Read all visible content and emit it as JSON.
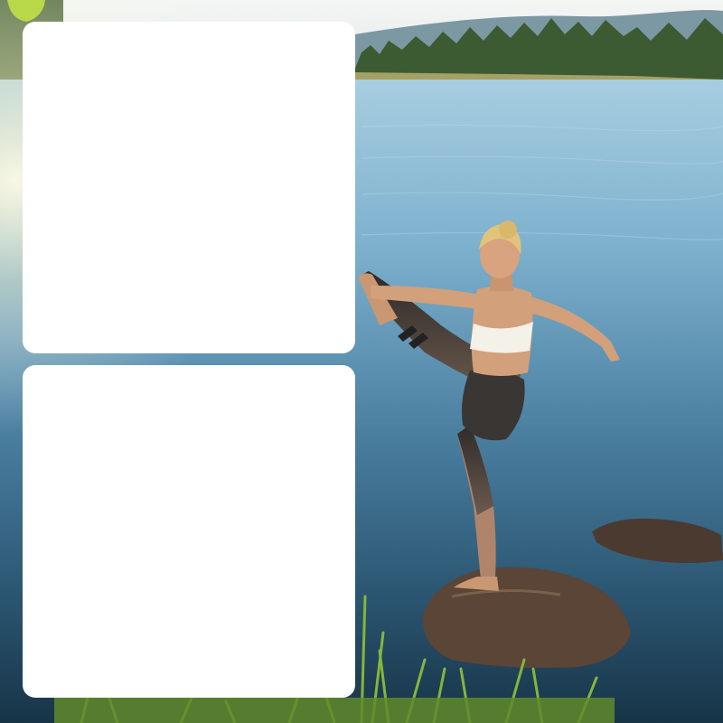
{
  "scene": {
    "description_icon": "photo-background",
    "colors": {
      "sky": "#e9eef0",
      "hills": "#6f8f9a",
      "treeline": "#3f5a35",
      "shore": "#9c9a5e",
      "water_top": "#a9d0e3",
      "water_mid": "#4d86a8",
      "water_bottom": "#1c3d55",
      "rock": "#5b4637",
      "grass": "#7fae3a",
      "skin": "#d7a37c",
      "hair": "#e2c37a",
      "top": "#f4f2ea",
      "leggings": "#3a3634",
      "card": "#ffffff"
    }
  },
  "panels": [
    {
      "text": ""
    },
    {
      "text": ""
    }
  ]
}
